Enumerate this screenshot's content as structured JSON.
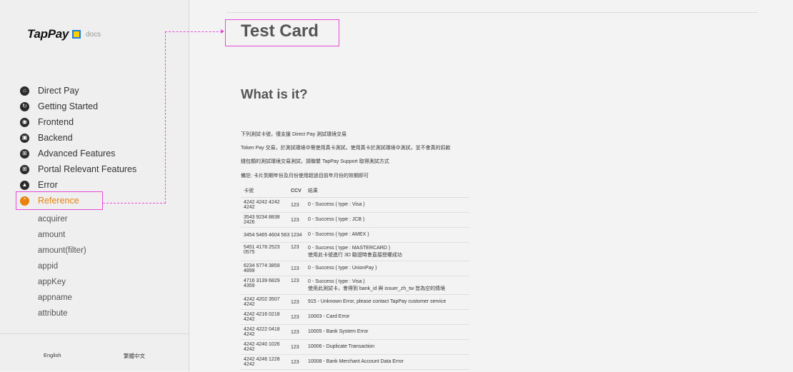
{
  "sidebar": {
    "logo_text": "TapPay",
    "logo_docs": "docs",
    "nav": [
      {
        "label": "Direct Pay",
        "icon": "⌂",
        "active": false
      },
      {
        "label": "Getting Started",
        "icon": "↻",
        "active": false
      },
      {
        "label": "Frontend",
        "icon": "◉",
        "active": false
      },
      {
        "label": "Backend",
        "icon": "▣",
        "active": false
      },
      {
        "label": "Advanced Features",
        "icon": "⊞",
        "active": false
      },
      {
        "label": "Portal Relevant Features",
        "icon": "⊞",
        "active": false
      },
      {
        "label": "Error",
        "icon": "▲",
        "active": false
      },
      {
        "label": "Reference",
        "icon": "⌃",
        "active": true
      }
    ],
    "sub_nav": [
      "acquirer",
      "amount",
      "amount(filter)",
      "appid",
      "appKey",
      "appname",
      "attribute"
    ],
    "footer": {
      "english": "English",
      "trad_chinese": "繁體中文"
    }
  },
  "main": {
    "page_title": "Test Card",
    "section_title": "What is it?",
    "paragraphs": [
      "下列測試卡號，僅支援 Direct Pay 測試環境交易",
      "Token Pay 交易，於測試環境中需使用真卡測試，使用真卡於測試環境中測試，並不會真的扣款",
      "錢包類的測試環境交易測試，請聯繫 TapPay Support 取得測試方式",
      "備註: 卡片到期年份及月份使用超過目前年月份的效期即可"
    ],
    "table": {
      "headers": [
        "卡號",
        "CCV",
        "結果"
      ],
      "rows": [
        {
          "card": "4242 4242 4242 4242",
          "ccv": "123",
          "result": [
            "0 - Success ( type : Visa )"
          ]
        },
        {
          "card": "3543 9234 8838 2426",
          "ccv": "123",
          "result": [
            "0 - Success ( type : JCB )"
          ]
        },
        {
          "card": "3454 5465 4604 563",
          "ccv": "1234",
          "result": [
            "0 - Success ( type : AMEX )"
          ]
        },
        {
          "card": "5451 4178 2523 0575",
          "ccv": "123",
          "result": [
            "0 - Success ( type : MASTERCARD )",
            "使用此卡號進行 3D 驗證時會直接授權成功"
          ]
        },
        {
          "card": "6234 5774 3859 4899",
          "ccv": "123",
          "result": [
            "0 - Success ( type : UnionPay )"
          ]
        },
        {
          "card": "4716 3139 6829 4359",
          "ccv": "123",
          "result": [
            "0 - Success ( type : Visa )",
            "使用此測試卡，會得到 bank_id 與 issuer_zh_tw 皆為空的情境"
          ]
        },
        {
          "card": "4242 4202 3507 4242",
          "ccv": "123",
          "result": [
            "915 - Unknown Error, please contact TapPay customer service"
          ]
        },
        {
          "card": "4242 4216 0218 4242",
          "ccv": "123",
          "result": [
            "10003 - Card Error"
          ]
        },
        {
          "card": "4242 4222 0418 4242",
          "ccv": "123",
          "result": [
            "10005 - Bank System Error"
          ]
        },
        {
          "card": "4242 4240 1026 4242",
          "ccv": "123",
          "result": [
            "10006 - Duplicate Transaction"
          ]
        },
        {
          "card": "4242 4246 1228 4242",
          "ccv": "123",
          "result": [
            "10008 - Bank Merchant Account Data Error"
          ]
        }
      ]
    }
  },
  "colors": {
    "accent": "#e8820c",
    "highlight": "#e84ad9",
    "logo_yellow": "#ffd000",
    "logo_blue": "#1f7ddb"
  }
}
